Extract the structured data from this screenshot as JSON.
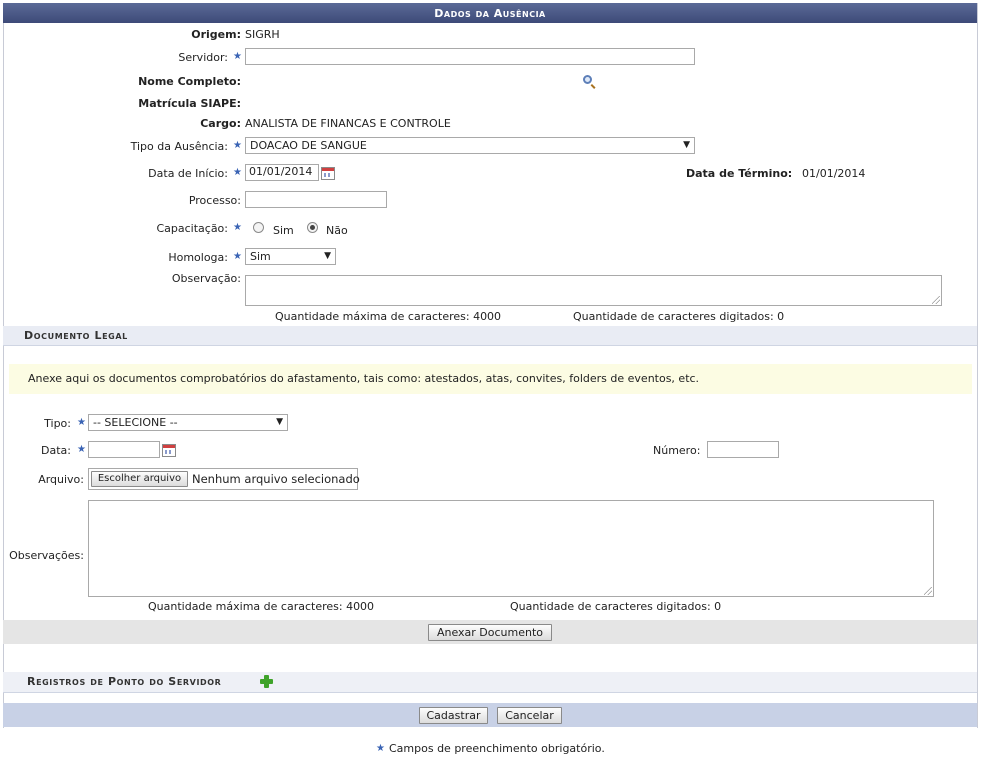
{
  "header": {
    "title": "Dados da Ausência"
  },
  "form": {
    "origem": {
      "label": "Origem:",
      "value": "SIGRH"
    },
    "servidor": {
      "label": "Servidor:",
      "value": ""
    },
    "nome_completo": {
      "label": "Nome Completo:",
      "value": ""
    },
    "matricula": {
      "label": "Matrícula SIAPE:",
      "value": ""
    },
    "cargo": {
      "label": "Cargo:",
      "value": "ANALISTA DE FINANCAS E CONTROLE"
    },
    "tipo_ausencia": {
      "label": "Tipo da Ausência:",
      "value": "DOACAO DE SANGUE"
    },
    "data_inicio": {
      "label": "Data de Início:",
      "value": "01/01/2014"
    },
    "data_termino": {
      "label": "Data de Término:",
      "value": "01/01/2014"
    },
    "processo": {
      "label": "Processo:",
      "value": ""
    },
    "capacitacao": {
      "label": "Capacitação:",
      "options": [
        "Sim",
        "Não"
      ],
      "selected": "Não"
    },
    "homologa": {
      "label": "Homologa:",
      "value": "Sim"
    },
    "observacao": {
      "label": "Observação:",
      "value": "",
      "max_chars": "Quantidade máxima de caracteres: 4000",
      "typed_chars": "Quantidade de caracteres digitados: 0"
    }
  },
  "documento_legal": {
    "title": "Documento Legal",
    "notice": "Anexe aqui os documentos comprobatórios do afastamento, tais como: atestados, atas, convites, folders de eventos, etc.",
    "tipo": {
      "label": "Tipo:",
      "value": "-- SELECIONE --"
    },
    "data": {
      "label": "Data:",
      "value": ""
    },
    "numero": {
      "label": "Número:",
      "value": ""
    },
    "arquivo": {
      "label": "Arquivo:",
      "button": "Escolher arquivo",
      "status": "Nenhum arquivo selecionado"
    },
    "observacoes": {
      "label": "Observações:",
      "value": "",
      "max_chars": "Quantidade máxima de caracteres: 4000",
      "typed_chars": "Quantidade de caracteres digitados: 0"
    },
    "anexar_button": "Anexar Documento"
  },
  "registros": {
    "title": "Registros de Ponto do Servidor"
  },
  "actions": {
    "cadastrar": "Cadastrar",
    "cancelar": "Cancelar"
  },
  "footer": {
    "required_note": "Campos de preenchimento obrigatório."
  },
  "colors": {
    "header_bg": "#3d4a78",
    "required_star": "#3a63b4",
    "notice_bg": "#fcfce3",
    "section_bg": "#e9ecf4",
    "footer_bar": "#c8d1e6"
  },
  "icons": {
    "required": "star-icon",
    "search": "magnifier-icon",
    "calendar": "calendar-icon",
    "add": "plus-icon"
  }
}
